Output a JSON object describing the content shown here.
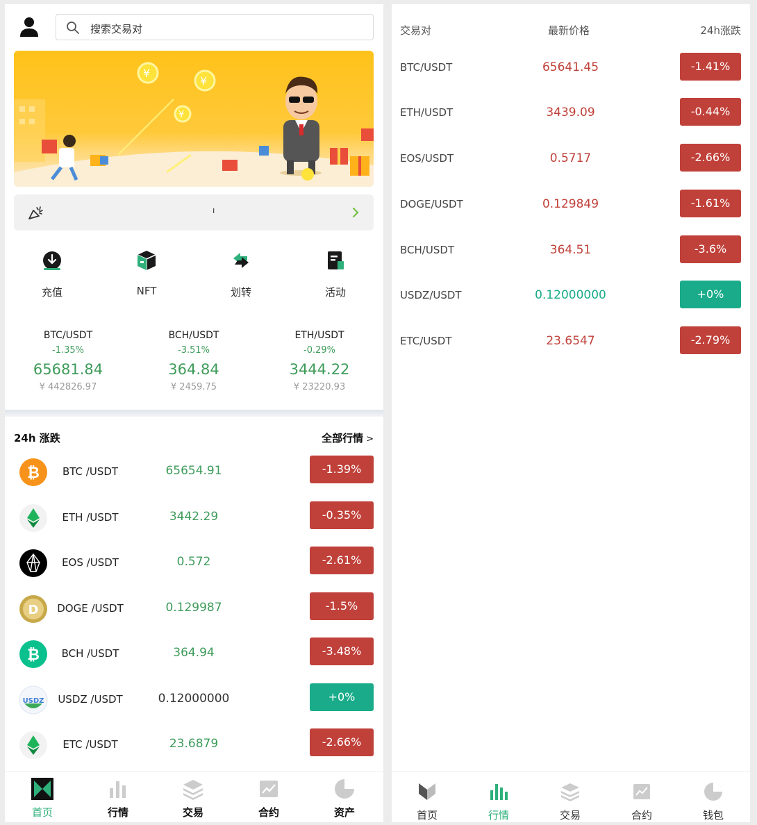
{
  "search": {
    "placeholder": "搜索交易对"
  },
  "notice": {
    "text": "ı"
  },
  "quick_actions": [
    {
      "label": "充值",
      "icon": "deposit-icon"
    },
    {
      "label": "NFT",
      "icon": "nft-box-icon"
    },
    {
      "label": "划转",
      "icon": "transfer-icon"
    },
    {
      "label": "活动",
      "icon": "activity-icon"
    }
  ],
  "tickers": [
    {
      "pair": "BTC/USDT",
      "change": "-1.35%",
      "price": "65681.84",
      "cny": "¥ 442826.97"
    },
    {
      "pair": "BCH/USDT",
      "change": "-3.51%",
      "price": "364.84",
      "cny": "¥ 2459.75"
    },
    {
      "pair": "ETH/USDT",
      "change": "-0.29%",
      "price": "3444.22",
      "cny": "¥ 23220.93"
    }
  ],
  "market_section": {
    "title": "24h 涨跌",
    "all_label": "全部行情",
    "all_arrow": ">"
  },
  "market_rows": [
    {
      "pair": "BTC /USDT",
      "price": "65654.91",
      "change": "-1.39%",
      "dir": "down",
      "icon": "bitcoin-icon",
      "color": "#f7931a"
    },
    {
      "pair": "ETH /USDT",
      "price": "3442.29",
      "change": "-0.35%",
      "dir": "down",
      "icon": "ethereum-icon",
      "color": "#1fb45a"
    },
    {
      "pair": "EOS /USDT",
      "price": "0.572",
      "change": "-2.61%",
      "dir": "down",
      "icon": "eos-icon",
      "color": "#000000"
    },
    {
      "pair": "DOGE /USDT",
      "price": "0.129987",
      "change": "-1.5%",
      "dir": "down",
      "icon": "dogecoin-icon",
      "color": "#c8a94a"
    },
    {
      "pair": "BCH /USDT",
      "price": "364.94",
      "change": "-3.48%",
      "dir": "down",
      "icon": "bitcoin-cash-icon",
      "color": "#0ac18e"
    },
    {
      "pair": "USDZ /USDT",
      "price": "0.12000000",
      "change": "+0%",
      "dir": "flat",
      "icon": "usdz-icon",
      "color": "#3f7fd8"
    },
    {
      "pair": "ETC /USDT",
      "price": "23.6879",
      "change": "-2.66%",
      "dir": "down",
      "icon": "ethereum-classic-icon",
      "color": "#1fb45a"
    }
  ],
  "left_nav": [
    {
      "label": "首页",
      "icon": "home-logo-icon",
      "active": true
    },
    {
      "label": "行情",
      "icon": "bar-chart-icon",
      "active": false
    },
    {
      "label": "交易",
      "icon": "layers-icon",
      "active": false
    },
    {
      "label": "合约",
      "icon": "trend-chart-icon",
      "active": false
    },
    {
      "label": "资产",
      "icon": "pie-chart-icon",
      "active": false
    }
  ],
  "right_header": {
    "col_pair": "交易对",
    "col_price": "最新价格",
    "col_change": "24h涨跌"
  },
  "right_rows": [
    {
      "pair": "BTC/USDT",
      "price": "65641.45",
      "change": "-1.41%",
      "dir": "down"
    },
    {
      "pair": "ETH/USDT",
      "price": "3439.09",
      "change": "-0.44%",
      "dir": "down"
    },
    {
      "pair": "EOS/USDT",
      "price": "0.5717",
      "change": "-2.66%",
      "dir": "down"
    },
    {
      "pair": "DOGE/USDT",
      "price": "0.129849",
      "change": "-1.61%",
      "dir": "down"
    },
    {
      "pair": "BCH/USDT",
      "price": "364.51",
      "change": "-3.6%",
      "dir": "down"
    },
    {
      "pair": "USDZ/USDT",
      "price": "0.12000000",
      "change": "+0%",
      "dir": "up"
    },
    {
      "pair": "ETC/USDT",
      "price": "23.6547",
      "change": "-2.79%",
      "dir": "down"
    }
  ],
  "right_nav": [
    {
      "label": "首页",
      "icon": "home-logo-icon",
      "active": false
    },
    {
      "label": "行情",
      "icon": "bar-chart-icon",
      "active": true
    },
    {
      "label": "交易",
      "icon": "layers-icon",
      "active": false
    },
    {
      "label": "合约",
      "icon": "trend-chart-icon",
      "active": false
    },
    {
      "label": "钱包",
      "icon": "pie-chart-icon",
      "active": false
    }
  ],
  "colors": {
    "up": "#3e9b5a",
    "down_badge": "#c0413a",
    "up_badge": "#1aac8a",
    "nav_active": "#2fb07b"
  }
}
